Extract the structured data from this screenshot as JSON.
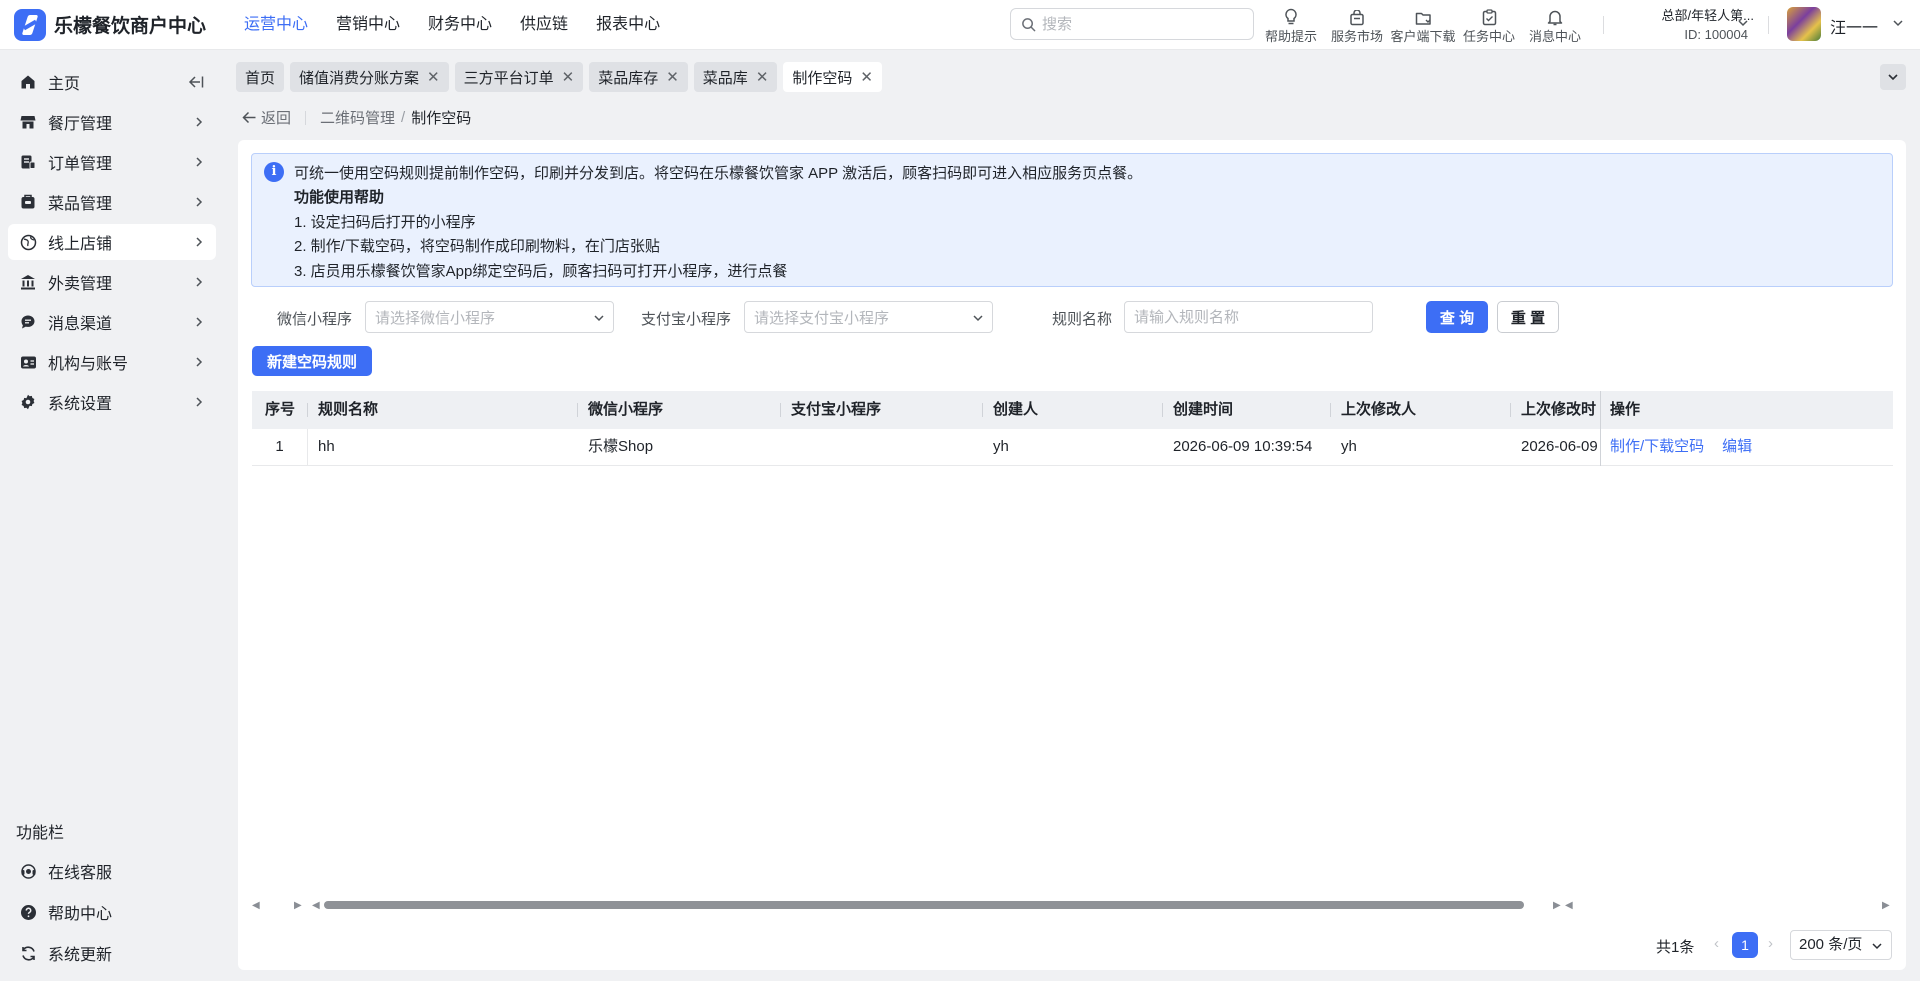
{
  "app": {
    "title": "乐檬餐饮商户中心"
  },
  "topnav": [
    {
      "label": "运营中心",
      "active": true
    },
    {
      "label": "营销中心"
    },
    {
      "label": "财务中心"
    },
    {
      "label": "供应链"
    },
    {
      "label": "报表中心"
    }
  ],
  "search": {
    "placeholder": "搜索"
  },
  "tools": [
    {
      "label": "帮助提示",
      "icon": "lightbulb-icon"
    },
    {
      "label": "服务市场",
      "icon": "shop-bag-icon"
    },
    {
      "label": "客户端下载",
      "icon": "download-folder-icon"
    },
    {
      "label": "任务中心",
      "icon": "clipboard-icon"
    },
    {
      "label": "消息中心",
      "icon": "bell-icon"
    }
  ],
  "org": {
    "name": "总部/年轻人第...",
    "id": "ID: 100004"
  },
  "user": {
    "name": "汪一一"
  },
  "sidebar": {
    "items": [
      {
        "label": "主页",
        "icon": "home-icon"
      },
      {
        "label": "餐厅管理",
        "icon": "store-icon"
      },
      {
        "label": "订单管理",
        "icon": "order-icon"
      },
      {
        "label": "菜品管理",
        "icon": "dish-icon"
      },
      {
        "label": "线上店铺",
        "icon": "globe-icon",
        "active": true
      },
      {
        "label": "外卖管理",
        "icon": "bank-icon"
      },
      {
        "label": "消息渠道",
        "icon": "chat-icon"
      },
      {
        "label": "机构与账号",
        "icon": "id-card-icon"
      },
      {
        "label": "系统设置",
        "icon": "gear-icon"
      }
    ],
    "func_title": "功能栏",
    "func_items": [
      {
        "label": "在线客服",
        "icon": "headset-icon"
      },
      {
        "label": "帮助中心",
        "icon": "help-circle-icon"
      },
      {
        "label": "系统更新",
        "icon": "refresh-icon"
      }
    ]
  },
  "tabs": [
    {
      "label": "首页",
      "closable": false
    },
    {
      "label": "储值消费分账方案",
      "closable": true
    },
    {
      "label": "三方平台订单",
      "closable": true
    },
    {
      "label": "菜品库存",
      "closable": true
    },
    {
      "label": "菜品库",
      "closable": true
    },
    {
      "label": "制作空码",
      "closable": true,
      "active": true
    }
  ],
  "breadcrumb": {
    "back": "返回",
    "parent": "二维码管理",
    "sep": "/",
    "current": "制作空码"
  },
  "notice": {
    "line1": "可统一使用空码规则提前制作空码，印刷并分发到店。将空码在乐檬餐饮管家 APP 激活后，顾客扫码即可进入相应服务页点餐。",
    "title": "功能使用帮助",
    "step1": "1. 设定扫码后打开的小程序",
    "step2": "2. 制作/下载空码，将空码制作成印刷物料，在门店张贴",
    "step3": "3. 店员用乐檬餐饮管家App绑定空码后，顾客扫码可打开小程序，进行点餐"
  },
  "filters": {
    "wechat_label": "微信小程序",
    "wechat_placeholder": "请选择微信小程序",
    "alipay_label": "支付宝小程序",
    "alipay_placeholder": "请选择支付宝小程序",
    "rule_label": "规则名称",
    "rule_placeholder": "请输入规则名称",
    "query": "查 询",
    "reset": "重 置"
  },
  "new_button": "新建空码规则",
  "table": {
    "headers": [
      "序号",
      "规则名称",
      "微信小程序",
      "支付宝小程序",
      "创建人",
      "创建时间",
      "上次修改人",
      "上次修改时",
      "操作"
    ],
    "rows": [
      {
        "no": "1",
        "name": "hh",
        "wechat": "乐檬Shop",
        "alipay": "",
        "creator": "yh",
        "created": "2026-06-09 10:39:54",
        "modifier": "yh",
        "modified": "2026-06-09"
      }
    ],
    "actions": {
      "make": "制作/下载空码",
      "edit": "编辑"
    }
  },
  "pagination": {
    "total": "共1条",
    "current": "1",
    "page_size": "200 条/页"
  },
  "colors": {
    "accent": "#3d6ef5",
    "notice_bg": "#eaf1fe",
    "sidebar_bg": "#f0f1f3"
  }
}
